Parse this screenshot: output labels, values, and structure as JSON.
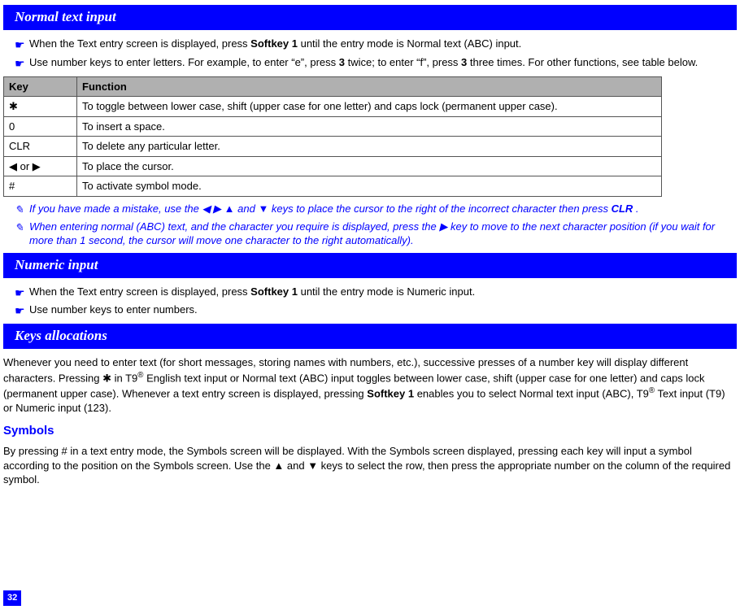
{
  "sections": {
    "normal": {
      "title": "Normal text input",
      "bullets": [
        {
          "pre": "When the Text entry screen is displayed, press ",
          "bold1": "Softkey 1",
          "post1": " until the entry mode is Normal text (ABC) input."
        },
        {
          "pre": "Use number keys to enter letters. For example, to enter “e”, press ",
          "bold1": "3",
          "mid": " twice; to enter “f”, press ",
          "bold2": "3",
          "post2": " three times. For other functions, see table below."
        }
      ],
      "table": {
        "headers": {
          "key": "Key",
          "function": "Function"
        },
        "rows": [
          {
            "key": "✱",
            "function": "To toggle between lower case, shift (upper case for one letter) and caps lock (permanent upper case)."
          },
          {
            "key": "0",
            "function": "To insert a space."
          },
          {
            "key": "CLR",
            "function": "To delete any particular letter."
          },
          {
            "key": "◀ or ▶",
            "function": "To place the cursor."
          },
          {
            "key": "#",
            "function": "To activate symbol mode."
          }
        ]
      },
      "notes": [
        {
          "pre": "If you have made a mistake, use the ◀ ▶ ▲ and ▼ keys to place the cursor to the right of the incorrect character then press  ",
          "bold": "CLR",
          "post": " ."
        },
        {
          "pre": "When entering normal (ABC) text, and the character you require is displayed, press the ▶ key to move to the next character position (if you wait for more than 1 second, the cursor will move one character to the right automatically)."
        }
      ]
    },
    "numeric": {
      "title": "Numeric input",
      "bullets": [
        {
          "pre": "When the Text entry screen is displayed, press ",
          "bold1": "Softkey 1",
          "post1": " until the entry mode is Numeric input."
        },
        {
          "pre": "Use number keys to enter numbers."
        }
      ]
    },
    "keys": {
      "title": "Keys allocations",
      "para_pre": "Whenever you need to enter text (for short messages, storing names with numbers, etc.), successive presses of a number key will display different characters. Pressing ✱ in T9",
      "para_mid1": " English text input or Normal text (ABC) input toggles between lower case, shift (upper case for one letter) and caps lock (permanent upper case). Whenever a text entry screen is displayed, pressing ",
      "para_bold": "Softkey 1",
      "para_mid2": " enables you to select Normal text input (ABC), T9",
      "para_post": " Text input (T9) or Numeric input (123).",
      "symbols_heading": "Symbols",
      "symbols_para": "By pressing # in a text entry mode, the Symbols screen will be displayed. With the Symbols screen displayed, pressing each key will input a symbol according to the position on the Symbols screen. Use the ▲ and ▼ keys to select the row, then press the appropriate number on the column of the required symbol."
    }
  },
  "page_number": "32"
}
